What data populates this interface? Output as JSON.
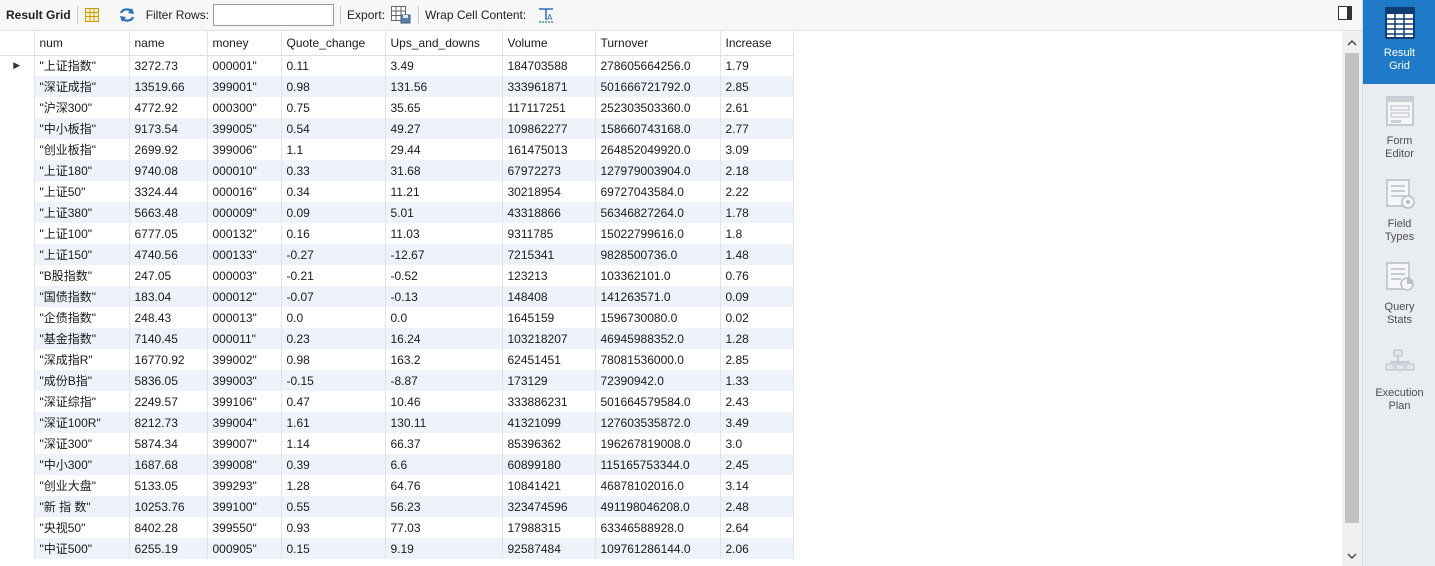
{
  "toolbar": {
    "result_grid": "Result Grid",
    "filter_rows": "Filter Rows:",
    "filter_value": "",
    "export": "Export:",
    "wrap_cell": "Wrap Cell Content:"
  },
  "columns": [
    "num",
    "name",
    "money",
    "Quote_change",
    "Ups_and_downs",
    "Volume",
    "Turnover",
    "Increase"
  ],
  "rows": [
    [
      "\"上证指数\"",
      "3272.73",
      "000001\"",
      "0.11",
      "3.49",
      "184703588",
      "278605664256.0",
      "1.79"
    ],
    [
      "\"深证成指\"",
      "13519.66",
      "399001\"",
      "0.98",
      "131.56",
      "333961871",
      "501666721792.0",
      "2.85"
    ],
    [
      "\"沪深300\"",
      "4772.92",
      "000300\"",
      "0.75",
      "35.65",
      "117117251",
      "252303503360.0",
      "2.61"
    ],
    [
      "\"中小板指\"",
      "9173.54",
      "399005\"",
      "0.54",
      "49.27",
      "109862277",
      "158660743168.0",
      "2.77"
    ],
    [
      "\"创业板指\"",
      "2699.92",
      "399006\"",
      "1.1",
      "29.44",
      "161475013",
      "264852049920.0",
      "3.09"
    ],
    [
      "\"上证180\"",
      "9740.08",
      "000010\"",
      "0.33",
      "31.68",
      "67972273",
      "127979003904.0",
      "2.18"
    ],
    [
      "\"上证50\"",
      "3324.44",
      "000016\"",
      "0.34",
      "11.21",
      "30218954",
      "69727043584.0",
      "2.22"
    ],
    [
      "\"上证380\"",
      "5663.48",
      "000009\"",
      "0.09",
      "5.01",
      "43318866",
      "56346827264.0",
      "1.78"
    ],
    [
      "\"上证100\"",
      "6777.05",
      "000132\"",
      "0.16",
      "11.03",
      "9311785",
      "15022799616.0",
      "1.8"
    ],
    [
      "\"上证150\"",
      "4740.56",
      "000133\"",
      "-0.27",
      "-12.67",
      "7215341",
      "9828500736.0",
      "1.48"
    ],
    [
      "\"B股指数\"",
      "247.05",
      "000003\"",
      "-0.21",
      "-0.52",
      "123213",
      "103362101.0",
      "0.76"
    ],
    [
      "\"国债指数\"",
      "183.04",
      "000012\"",
      "-0.07",
      "-0.13",
      "148408",
      "141263571.0",
      "0.09"
    ],
    [
      "\"企债指数\"",
      "248.43",
      "000013\"",
      "0.0",
      "0.0",
      "1645159",
      "1596730080.0",
      "0.02"
    ],
    [
      "\"基金指数\"",
      "7140.45",
      "000011\"",
      "0.23",
      "16.24",
      "103218207",
      "46945988352.0",
      "1.28"
    ],
    [
      "\"深成指R\"",
      "16770.92",
      "399002\"",
      "0.98",
      "163.2",
      "62451451",
      "78081536000.0",
      "2.85"
    ],
    [
      "\"成份B指\"",
      "5836.05",
      "399003\"",
      "-0.15",
      "-8.87",
      "173129",
      "72390942.0",
      "1.33"
    ],
    [
      "\"深证综指\"",
      "2249.57",
      "399106\"",
      "0.47",
      "10.46",
      "333886231",
      "501664579584.0",
      "2.43"
    ],
    [
      "\"深证100R\"",
      "8212.73",
      "399004\"",
      "1.61",
      "130.11",
      "41321099",
      "127603535872.0",
      "3.49"
    ],
    [
      "\"深证300\"",
      "5874.34",
      "399007\"",
      "1.14",
      "66.37",
      "85396362",
      "196267819008.0",
      "3.0"
    ],
    [
      "\"中小300\"",
      "1687.68",
      "399008\"",
      "0.39",
      "6.6",
      "60899180",
      "115165753344.0",
      "2.45"
    ],
    [
      "\"创业大盘\"",
      "5133.05",
      "399293\"",
      "1.28",
      "64.76",
      "10841421",
      "46878102016.0",
      "3.14"
    ],
    [
      "\"新 指 数\"",
      "10253.76",
      "399100\"",
      "0.55",
      "56.23",
      "323474596",
      "491198046208.0",
      "2.48"
    ],
    [
      "\"央视50\"",
      "8402.28",
      "399550\"",
      "0.93",
      "77.03",
      "17988315",
      "63346588928.0",
      "2.64"
    ],
    [
      "\"中证500\"",
      "6255.19",
      "000905\"",
      "0.15",
      "9.19",
      "92587484",
      "109761286144.0",
      "2.06"
    ]
  ],
  "sidebar": {
    "items": [
      {
        "label": "Result\nGrid",
        "icon": "result-grid-icon"
      },
      {
        "label": "Form\nEditor",
        "icon": "form-editor-icon"
      },
      {
        "label": "Field\nTypes",
        "icon": "field-types-icon"
      },
      {
        "label": "Query\nStats",
        "icon": "query-stats-icon"
      },
      {
        "label": "Execution\nPlan",
        "icon": "execution-plan-icon"
      }
    ]
  },
  "colors": {
    "accent": "#1f7ac7",
    "row_alt": "#eef3fb",
    "sidebar_bg": "#e9edf1"
  }
}
